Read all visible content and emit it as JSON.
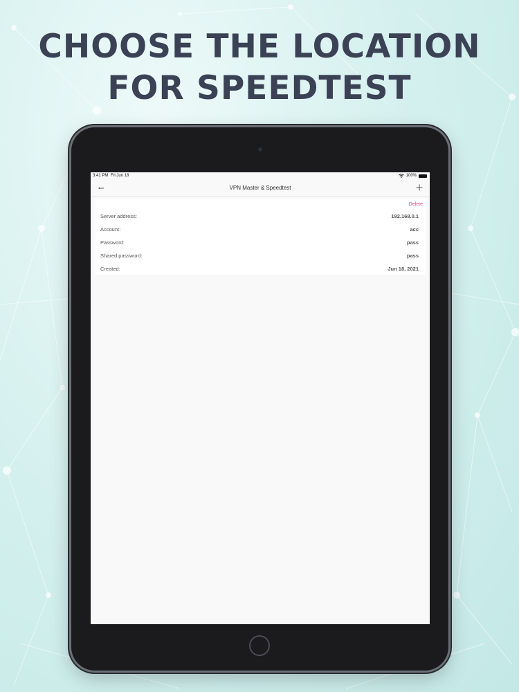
{
  "headline": {
    "line1": "CHOOSE THE LOCATION",
    "line2": "FOR SPEEDTEST"
  },
  "status_bar": {
    "time": "3:41 PM",
    "date": "Fri Jun 18",
    "battery": "100%",
    "battery_level": 1.0
  },
  "nav": {
    "title": "VPN Master & Speedtest",
    "back_icon": "back-icon",
    "add_icon": "plus-icon"
  },
  "details": {
    "delete_label": "Delete",
    "rows": [
      {
        "label": "Server address:",
        "value": "192.168.0.1"
      },
      {
        "label": "Account:",
        "value": "acc"
      },
      {
        "label": "Password:",
        "value": "pass"
      },
      {
        "label": "Shared password:",
        "value": "pass"
      },
      {
        "label": "Created:",
        "value": "Jun 18, 2021"
      }
    ]
  },
  "colors": {
    "headline": "#3b4255",
    "accent_delete": "#e8478a",
    "background": "#d6f1ef"
  }
}
